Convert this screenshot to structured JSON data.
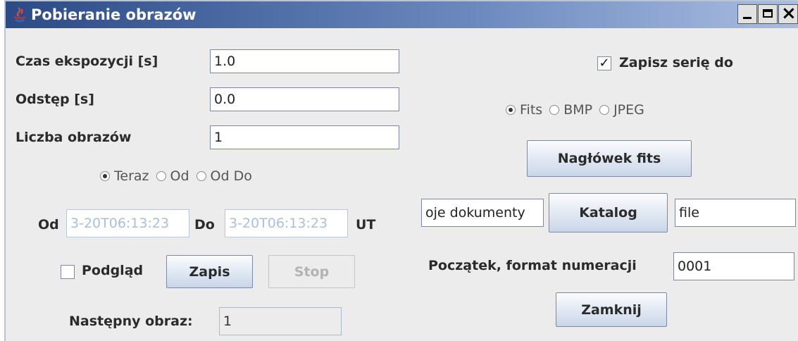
{
  "window": {
    "title": "Pobieranie obrazów",
    "controls": {
      "minimize": "_",
      "maximize": "□",
      "close": "×"
    }
  },
  "exposure": {
    "label": "Czas ekspozycji [s]",
    "value": "1.0"
  },
  "interval": {
    "label": "Odstęp [s]",
    "value": "0.0"
  },
  "count": {
    "label": "Liczba obrazów",
    "value": "1"
  },
  "timing": {
    "options": [
      {
        "label": "Teraz",
        "selected": true
      },
      {
        "label": "Od",
        "selected": false
      },
      {
        "label": "Od Do",
        "selected": false
      }
    ]
  },
  "range": {
    "from_label": "Od",
    "from_value": "3-20T06:13:23",
    "to_label": "Do",
    "to_value": "3-20T06:13:23",
    "unit": "UT"
  },
  "preview": {
    "label": "Podgląd",
    "checked": false
  },
  "buttons": {
    "save": "Zapis",
    "stop": "Stop",
    "header": "Nagłówek fits",
    "catalog": "Katalog",
    "close": "Zamknij"
  },
  "next_image": {
    "label": "Następny obraz:",
    "value": "1"
  },
  "save_series": {
    "label": "Zapisz serię do",
    "checked": true
  },
  "format": {
    "options": [
      {
        "label": "Fits",
        "selected": true
      },
      {
        "label": "BMP",
        "selected": false
      },
      {
        "label": "JPEG",
        "selected": false
      }
    ]
  },
  "directory": {
    "value": "oje dokumenty"
  },
  "filename": {
    "value": "file"
  },
  "numbering": {
    "label": "Początek, format numeracji",
    "value": "0001"
  }
}
